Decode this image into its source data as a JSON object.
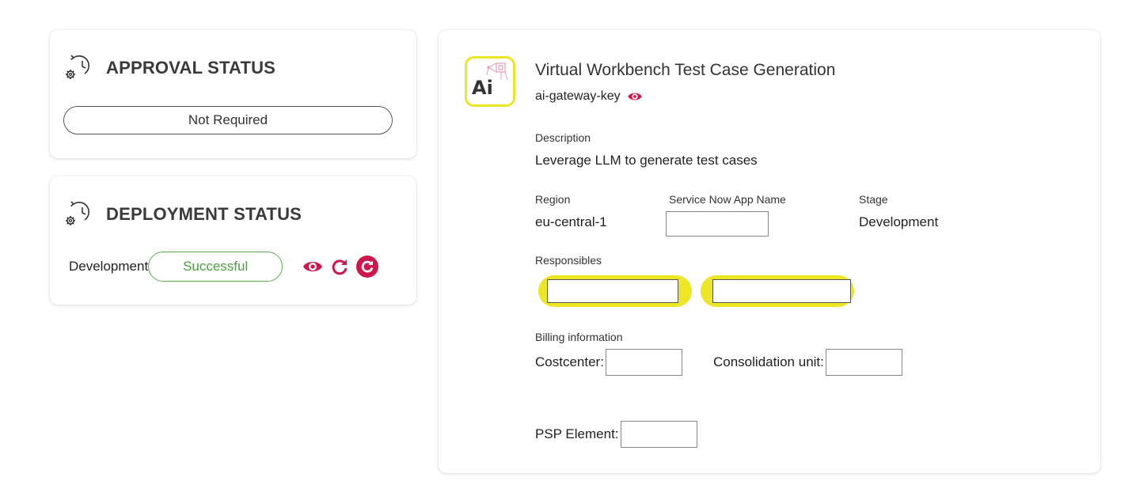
{
  "approval": {
    "title": "APPROVAL STATUS",
    "status": "Not Required"
  },
  "deployment": {
    "title": "DEPLOYMENT STATUS",
    "environment": "Development",
    "status": "Successful",
    "status_color": "#4c9d40"
  },
  "app": {
    "title": "Virtual Workbench Test Case Generation",
    "key_name": "ai-gateway-key",
    "logo_text": "Ai",
    "description_label": "Description",
    "description": "Leverage LLM to generate test cases",
    "region_label": "Region",
    "region": "eu-central-1",
    "service_now_label": "Service Now App Name",
    "service_now_value": "",
    "stage_label": "Stage",
    "stage": "Development",
    "responsibles_label": "Responsibles",
    "billing_label": "Billing information",
    "costcenter_label": "Costcenter:",
    "consolidation_label": "Consolidation unit:",
    "psp_label": "PSP Element:"
  },
  "colors": {
    "accent": "#d0154d",
    "highlight": "#ece624",
    "success": "#4c9d40"
  },
  "icons": {
    "status": "clock-gear-icon",
    "view": "eye-icon",
    "refresh": "refresh-icon",
    "redeploy": "circle-refresh-icon"
  }
}
